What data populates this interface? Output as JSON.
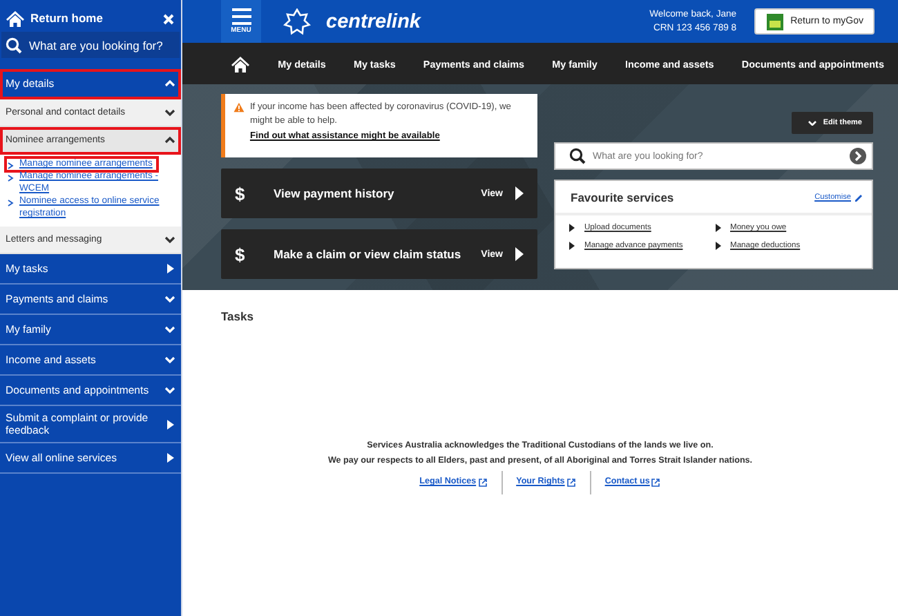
{
  "sidebar": {
    "home": "Return home",
    "search": {
      "placeholder": "What are you looking for?"
    },
    "sections": [
      {
        "label": "My details",
        "kind": "expandable",
        "expanded": true,
        "highlighted": true,
        "children": [
          {
            "label": "Personal and contact details",
            "kind": "expandable",
            "expanded": false,
            "highlighted": false
          },
          {
            "label": "Nominee arrangements",
            "kind": "expandable",
            "expanded": true,
            "highlighted": true,
            "children": [
              {
                "label": "Manage nominee arrangements",
                "kind": "link",
                "highlighted": true
              },
              {
                "label": "Manage nominee arrangements - WCEM",
                "kind": "link",
                "highlighted": false
              },
              {
                "label": "Nominee access to online service registration",
                "kind": "link",
                "highlighted": false
              }
            ]
          },
          {
            "label": "Letters and messaging",
            "kind": "expandable",
            "expanded": false,
            "highlighted": false
          }
        ]
      },
      {
        "label": "My tasks",
        "kind": "page",
        "highlighted": false
      },
      {
        "label": "Payments and claims",
        "kind": "expandable",
        "expanded": false,
        "highlighted": false
      },
      {
        "label": "My family",
        "kind": "expandable",
        "expanded": false,
        "highlighted": false
      },
      {
        "label": "Income and assets",
        "kind": "expandable",
        "expanded": false,
        "highlighted": false
      },
      {
        "label": "Documents and appointments",
        "kind": "expandable",
        "expanded": false,
        "highlighted": false
      },
      {
        "label": "Submit a complaint or provide feedback",
        "kind": "page",
        "highlighted": false
      },
      {
        "label": "View all online services",
        "kind": "page",
        "highlighted": false
      }
    ]
  },
  "header": {
    "menu_label": "MENU",
    "brand": "centrelink",
    "welcome": "Welcome back, Jane",
    "crn": "CRN 123 456 789 8",
    "mygov_button": "Return to myGov"
  },
  "nav": {
    "items": [
      "My details",
      "My tasks",
      "Payments and claims",
      "My family",
      "Income and assets",
      "Documents and appointments"
    ]
  },
  "alert": {
    "text": "If your income has been affected by coronavirus (COVID-19), we might be able to help.",
    "link": "Find out what assistance might be available"
  },
  "actions": [
    {
      "icon": "$",
      "title": "View payment history",
      "action": "View"
    },
    {
      "icon": "$",
      "title": "Make a claim or view claim status",
      "action": "View"
    }
  ],
  "edit_theme": "Edit theme",
  "search": {
    "placeholder": "What are you looking for?"
  },
  "favourites": {
    "title": "Favourite services",
    "customise": "Customise",
    "items": [
      "Upload documents",
      "Money you owe",
      "Manage advance payments",
      "Manage deductions"
    ]
  },
  "tasks_heading": "Tasks",
  "footer": {
    "lines": [
      "Services Australia acknowledges the Traditional Custodians of the lands we live on.",
      "We pay our respects to all Elders, past and present, of all Aboriginal and Torres Strait Islander nations."
    ],
    "links": [
      "Legal Notices",
      "Your Rights",
      "Contact us"
    ]
  }
}
